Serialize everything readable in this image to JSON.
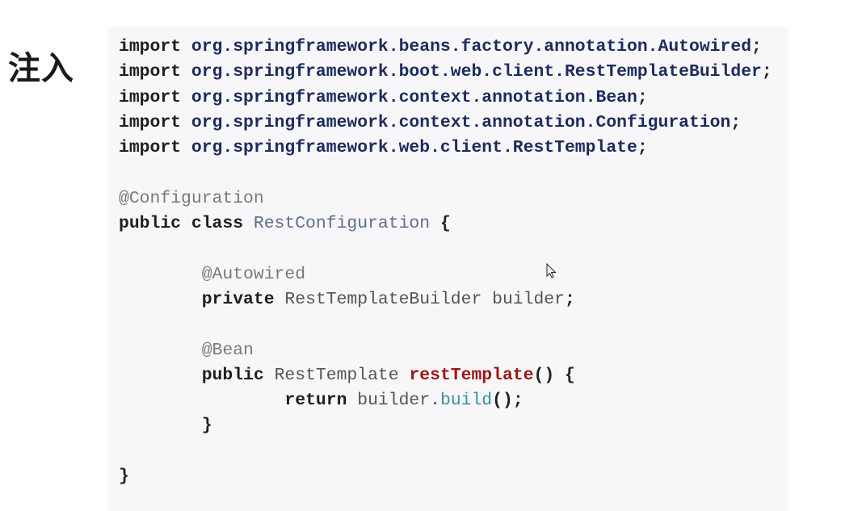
{
  "heading": "注入",
  "code_lines": [
    [
      {
        "t": "import ",
        "c": "kw"
      },
      {
        "t": "org.springframework.beans.factory.annotation.Autowired",
        "c": "pkg"
      },
      {
        "t": ";",
        "c": "punc"
      }
    ],
    [
      {
        "t": "import ",
        "c": "kw"
      },
      {
        "t": "org.springframework.boot.web.client.RestTemplateBuilder",
        "c": "pkg"
      },
      {
        "t": ";",
        "c": "punc"
      }
    ],
    [
      {
        "t": "import ",
        "c": "kw"
      },
      {
        "t": "org.springframework.context.annotation.Bean",
        "c": "pkg"
      },
      {
        "t": ";",
        "c": "punc"
      }
    ],
    [
      {
        "t": "import ",
        "c": "kw"
      },
      {
        "t": "org.springframework.context.annotation.Configuration",
        "c": "pkg"
      },
      {
        "t": ";",
        "c": "punc"
      }
    ],
    [
      {
        "t": "import ",
        "c": "kw"
      },
      {
        "t": "org.springframework.web.client.RestTemplate",
        "c": "pkg"
      },
      {
        "t": ";",
        "c": "punc"
      }
    ],
    [],
    [
      {
        "t": "@Configuration",
        "c": "ann"
      }
    ],
    [
      {
        "t": "public class ",
        "c": "kw"
      },
      {
        "t": "RestConfiguration",
        "c": "type"
      },
      {
        "t": " {",
        "c": "punc"
      }
    ],
    [],
    [
      {
        "t": "        @Autowired",
        "c": "ann"
      }
    ],
    [
      {
        "t": "        private ",
        "c": "kw"
      },
      {
        "t": "RestTemplateBuilder builder",
        "c": "plain"
      },
      {
        "t": ";",
        "c": "punc"
      }
    ],
    [],
    [
      {
        "t": "        @Bean",
        "c": "ann"
      }
    ],
    [
      {
        "t": "        public ",
        "c": "kw"
      },
      {
        "t": "RestTemplate ",
        "c": "plain"
      },
      {
        "t": "restTemplate",
        "c": "fn"
      },
      {
        "t": "() {",
        "c": "punc"
      }
    ],
    [
      {
        "t": "                return ",
        "c": "kw"
      },
      {
        "t": "builder.",
        "c": "plain"
      },
      {
        "t": "build",
        "c": "call"
      },
      {
        "t": "();",
        "c": "punc"
      }
    ],
    [
      {
        "t": "        }",
        "c": "punc"
      }
    ],
    [],
    [
      {
        "t": "}",
        "c": "punc"
      }
    ]
  ]
}
